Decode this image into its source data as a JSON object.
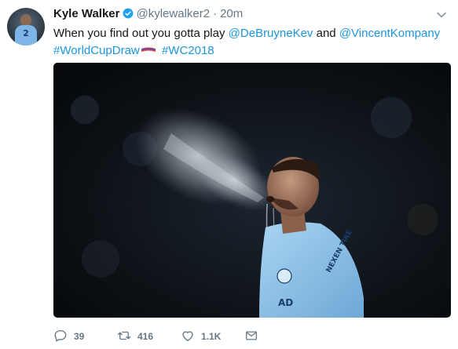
{
  "tweet": {
    "author": {
      "display_name": "Kyle Walker",
      "handle": "@kylewalker2",
      "separator": "·",
      "time": "20m",
      "avatar_number": "2"
    },
    "text": {
      "prefix": "When you find out you gotta play ",
      "mention1": "@DeBruyneKev",
      "conj": " and ",
      "mention2": "@VincentKompany",
      "hashtag1": "#WorldCupDraw",
      "hashtag2": "#WC2018"
    },
    "media": {
      "shirt_badge": "NEXEN TIRE",
      "shirt_text": "AD"
    },
    "actions": {
      "replies": "39",
      "retweets": "416",
      "likes": "1.1K"
    }
  },
  "colors": {
    "link": "#1b95e0",
    "muted": "#657786",
    "verified": "#1da1f2",
    "shirt": "#8ec3eb"
  },
  "icons": [
    "verified-badge-icon",
    "chevron-down-icon",
    "reply-icon",
    "retweet-icon",
    "like-icon",
    "direct-message-icon",
    "world-cup-flag-icon"
  ]
}
